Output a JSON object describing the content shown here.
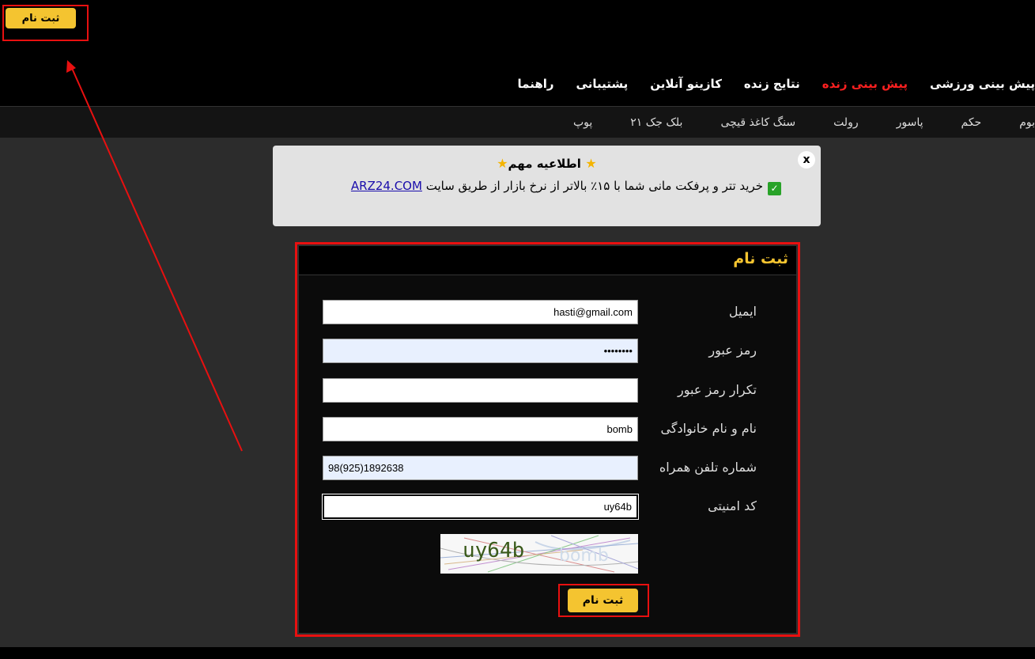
{
  "header": {
    "register_button": "ثبت نام",
    "main_nav": [
      "پیش بینی ورزشی",
      "پیش بینی زنده",
      "نتایج زنده",
      "کازینو آنلاین",
      "پشتیبانی",
      "راهنما"
    ],
    "main_nav_active": "پیش بینی زنده",
    "sub_nav": [
      "بوم",
      "حکم",
      "پاسور",
      "رولت",
      "سنگ کاغذ قیچی",
      "بلک جک ۲۱",
      "پوپ"
    ]
  },
  "notice": {
    "title": "اطلاعیه مهم",
    "text": "خرید تتر و پرفکت مانی شما با ۱۵٪ بالاتر از نرخ بازار از طریق سایت",
    "link": "ARZ24.COM",
    "close": "x"
  },
  "form": {
    "title": "ثبت نام",
    "email_label": "ایمیل",
    "email_value": "hasti@gmail.com",
    "password_label": "رمز عبور",
    "password_value": "••••••••",
    "confirm_label": "تکرار رمز عبور",
    "confirm_value": "",
    "fullname_label": "نام و نام خانوادگی",
    "fullname_value": "bomb",
    "phone_label": "شماره تلفن همراه",
    "phone_value": "98(925)1892638",
    "captcha_label": "کد امنیتی",
    "captcha_value": "uy64b",
    "captcha_image_text": "uy64b",
    "submit_label": "ثبت نام"
  },
  "colors": {
    "accent": "#f4c430",
    "active_nav": "#ff2020",
    "annotation": "#e81010"
  }
}
